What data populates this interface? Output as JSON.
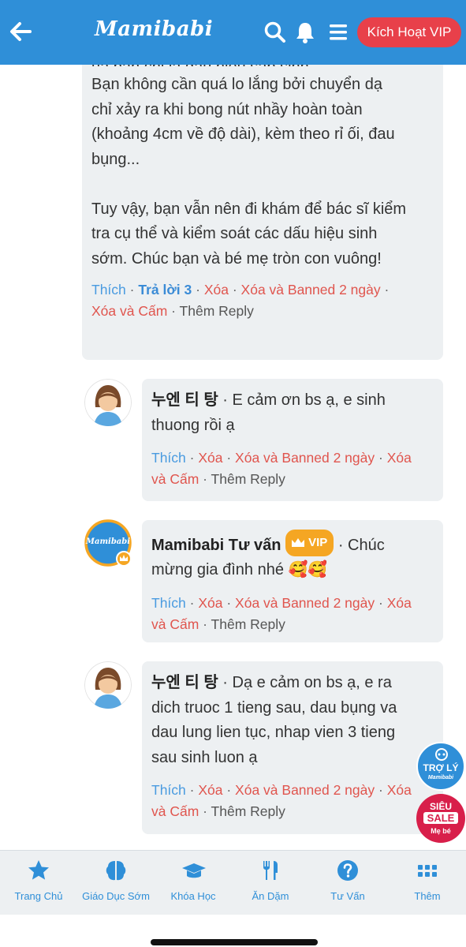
{
  "header": {
    "logo": "Mamibabi",
    "vip_button": "Kích Hoạt VIP"
  },
  "comments": [
    {
      "text_lines": [
        "Bạn không cần quá lo lắng bởi chuyển dạ",
        "chỉ xảy ra khi bong nút nhầy hoàn toàn",
        "(khoảng 4cm về độ dài), kèm theo rỉ ối, đau",
        "bụng...",
        "",
        "Tuy vậy, bạn vẫn nên đi khám để bác sĩ kiểm",
        "tra cụ thể và kiểm soát các dấu hiệu sinh",
        "sớm. Chúc bạn và bé mẹ tròn con vuông!"
      ],
      "actions": {
        "like": "Thích",
        "reply": "Trả lời 3",
        "delete": "Xóa",
        "delete_ban": "Xóa và Banned 2 ngày",
        "delete_block": "Xóa và Cấm",
        "more_reply": "Thêm Reply"
      }
    },
    {
      "author": "누엔 티 탕",
      "line1": "E cảm ơn bs ạ, e sinh",
      "line2": "thuong rồi ạ",
      "actions": {
        "like": "Thích",
        "delete": "Xóa",
        "delete_ban": "Xóa và Banned 2 ngày",
        "delete_block_1": "Xóa",
        "delete_block_2": "và Cấm",
        "more_reply": "Thêm Reply"
      }
    },
    {
      "author": "Mamibabi Tư vấn",
      "badge": "VIP",
      "line1": "Chúc",
      "line2": "mừng gia đình nhé 🥰🥰",
      "avatar_text": "Mamibabi",
      "actions": {
        "like": "Thích",
        "delete": "Xóa",
        "delete_ban": "Xóa và Banned 2 ngày",
        "delete_block_1": "Xóa",
        "delete_block_2": "và Cấm",
        "more_reply": "Thêm Reply"
      }
    },
    {
      "author": "누엔 티 탕",
      "line1": "Dạ e cảm on bs ạ, e ra",
      "line2": "dich truoc 1 tieng sau, dau bụng va",
      "line3": "dau lung lien tục, nhap vien 3 tieng",
      "line4": "sau sinh luon ạ",
      "actions": {
        "like": "Thích",
        "delete": "Xóa",
        "delete_ban": "Xóa và Banned 2 ngày",
        "delete_block_1": "Xóa",
        "delete_block_2": "và Cấm",
        "more_reply": "Thêm Reply"
      }
    }
  ],
  "floating": {
    "assistant_line1": "TRỢ LÝ",
    "assistant_line2": "Mamibabi",
    "sale_line1": "SIÊU",
    "sale_line2": "SALE",
    "sale_line3": "Mẹ bé"
  },
  "bottom_nav": [
    {
      "label": "Trang Chủ",
      "icon": "star-icon"
    },
    {
      "label": "Giáo Dục Sớm",
      "icon": "brain-icon"
    },
    {
      "label": "Khóa Học",
      "icon": "graduation-cap-icon"
    },
    {
      "label": "Ăn Dặm",
      "icon": "fork-knife-icon"
    },
    {
      "label": "Tư Vấn",
      "icon": "question-icon"
    },
    {
      "label": "Thêm",
      "icon": "grid-icon"
    }
  ],
  "colors": {
    "brand_blue": "#2f8fd8",
    "vip_red": "#e8404a",
    "action_red": "#e0554e",
    "vip_gold": "#f5a623"
  }
}
